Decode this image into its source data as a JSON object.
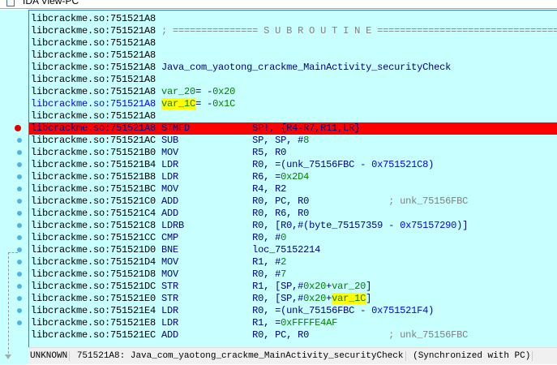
{
  "window_title": "IDA View-PC",
  "colors": {
    "bg": "#c8ffff",
    "breakpoint": "#ff0000",
    "highlight": "#ffff00"
  },
  "rows": [
    {
      "addr": "libcrackme.so:751521A8",
      "ac": "#000",
      "parts": []
    },
    {
      "addr": "libcrackme.so:751521A8",
      "ac": "#000",
      "parts": [
        {
          "t": "; =============== S U B R O U T I N E =======================================",
          "c": "#808080"
        }
      ]
    },
    {
      "addr": "libcrackme.so:751521A8",
      "ac": "#000",
      "parts": []
    },
    {
      "addr": "libcrackme.so:751521A8",
      "ac": "#000",
      "parts": []
    },
    {
      "addr": "libcrackme.so:751521A8",
      "ac": "#000",
      "parts": [
        {
          "t": "Java_com_yaotong_crackme_MainActivity_securityCheck",
          "c": "#000080"
        }
      ]
    },
    {
      "addr": "libcrackme.so:751521A8",
      "ac": "#000",
      "parts": []
    },
    {
      "addr": "libcrackme.so:751521A8",
      "ac": "#000",
      "parts": [
        {
          "t": "var_20",
          "c": "#008000"
        },
        {
          "t": "= -",
          "c": "#000080"
        },
        {
          "t": "0x20",
          "c": "#008000"
        }
      ]
    },
    {
      "addr": "libcrackme.so:751521A8",
      "ac": "#0000ff",
      "parts": [
        {
          "t": "var_1C",
          "c": "#008000",
          "hl": true
        },
        {
          "t": "= -",
          "c": "#000080"
        },
        {
          "t": "0x1C",
          "c": "#008000"
        }
      ]
    },
    {
      "addr": "libcrackme.so:751521A8",
      "ac": "#000",
      "parts": []
    },
    {
      "addr": "libcrackme.so:751521A8",
      "ac": "#000080",
      "bp": true,
      "parts": [
        {
          "t": "STMFD           ",
          "c": "#000080"
        },
        {
          "t": "SP!, {R4-R7,R11,LR}",
          "c": "#000080"
        }
      ]
    },
    {
      "addr": "libcrackme.so:751521AC",
      "ac": "#000",
      "dot": true,
      "parts": [
        {
          "t": "SUB             SP, SP, #",
          "c": "#000080"
        },
        {
          "t": "8",
          "c": "#008000"
        }
      ]
    },
    {
      "addr": "libcrackme.so:751521B0",
      "ac": "#000",
      "dot": true,
      "parts": [
        {
          "t": "MOV             R5, R0",
          "c": "#000080"
        }
      ]
    },
    {
      "addr": "libcrackme.so:751521B4",
      "ac": "#000",
      "dot": true,
      "parts": [
        {
          "t": "LDR             R0, =(unk_75156FBC - ",
          "c": "#000080"
        },
        {
          "t": "0x751521C8",
          "c": "#0000ff"
        },
        {
          "t": ")",
          "c": "#000080"
        }
      ]
    },
    {
      "addr": "libcrackme.so:751521B8",
      "ac": "#000",
      "dot": true,
      "parts": [
        {
          "t": "LDR             R6, =",
          "c": "#000080"
        },
        {
          "t": "0x2D4",
          "c": "#008000"
        }
      ]
    },
    {
      "addr": "libcrackme.so:751521BC",
      "ac": "#000",
      "dot": true,
      "parts": [
        {
          "t": "MOV             R4, R2",
          "c": "#000080"
        }
      ]
    },
    {
      "addr": "libcrackme.so:751521C0",
      "ac": "#000",
      "dot": true,
      "parts": [
        {
          "t": "ADD             R0, PC, R0              ",
          "c": "#000080"
        },
        {
          "t": "; unk_75156FBC",
          "c": "#808080"
        }
      ]
    },
    {
      "addr": "libcrackme.so:751521C4",
      "ac": "#000",
      "dot": true,
      "parts": [
        {
          "t": "ADD             R0, R6, R0",
          "c": "#000080"
        }
      ]
    },
    {
      "addr": "libcrackme.so:751521C8",
      "ac": "#000",
      "dot": true,
      "parts": [
        {
          "t": "LDRB            R0, [R0,#(byte_75157359 - ",
          "c": "#000080"
        },
        {
          "t": "0x75157290",
          "c": "#0000ff"
        },
        {
          "t": ")]",
          "c": "#000080"
        }
      ]
    },
    {
      "addr": "libcrackme.so:751521CC",
      "ac": "#000",
      "dot": true,
      "parts": [
        {
          "t": "CMP             R0, #",
          "c": "#000080"
        },
        {
          "t": "0",
          "c": "#008000"
        }
      ]
    },
    {
      "addr": "libcrackme.so:751521D0",
      "ac": "#000",
      "dot": true,
      "parts": [
        {
          "t": "BNE             loc_75152214",
          "c": "#000080"
        }
      ]
    },
    {
      "addr": "libcrackme.so:751521D4",
      "ac": "#000",
      "dot": true,
      "parts": [
        {
          "t": "MOV             R1, #",
          "c": "#000080"
        },
        {
          "t": "2",
          "c": "#008000"
        }
      ]
    },
    {
      "addr": "libcrackme.so:751521D8",
      "ac": "#000",
      "dot": true,
      "parts": [
        {
          "t": "MOV             R0, #",
          "c": "#000080"
        },
        {
          "t": "7",
          "c": "#008000"
        }
      ]
    },
    {
      "addr": "libcrackme.so:751521DC",
      "ac": "#000",
      "dot": true,
      "parts": [
        {
          "t": "STR             R1, [SP,#",
          "c": "#000080"
        },
        {
          "t": "0x20",
          "c": "#008000"
        },
        {
          "t": "+",
          "c": "#000080"
        },
        {
          "t": "var_20",
          "c": "#008000"
        },
        {
          "t": "]",
          "c": "#000080"
        }
      ]
    },
    {
      "addr": "libcrackme.so:751521E0",
      "ac": "#000",
      "dot": true,
      "parts": [
        {
          "t": "STR             R0, [SP,#",
          "c": "#000080"
        },
        {
          "t": "0x20",
          "c": "#008000"
        },
        {
          "t": "+",
          "c": "#000080"
        },
        {
          "t": "var_1C",
          "c": "#008000",
          "hl": true
        },
        {
          "t": "]",
          "c": "#000080"
        }
      ]
    },
    {
      "addr": "libcrackme.so:751521E4",
      "ac": "#000",
      "dot": true,
      "parts": [
        {
          "t": "LDR             R0, =(unk_75156FBC - ",
          "c": "#000080"
        },
        {
          "t": "0x751521F4",
          "c": "#0000ff"
        },
        {
          "t": ")",
          "c": "#000080"
        }
      ]
    },
    {
      "addr": "libcrackme.so:751521E8",
      "ac": "#000",
      "dot": true,
      "parts": [
        {
          "t": "LDR             R1, =",
          "c": "#000080"
        },
        {
          "t": "0xFFFFE4AF",
          "c": "#008000"
        }
      ]
    },
    {
      "addr": "libcrackme.so:751521EC",
      "ac": "#000",
      "parts": [
        {
          "t": "ADD             R0, PC, R0              ",
          "c": "#000080"
        },
        {
          "t": "; unk_75156FBC",
          "c": "#808080"
        }
      ]
    }
  ],
  "status": {
    "segment": "UNKNOWN",
    "location": "751521A8: Java_com_yaotong_crackme_MainActivity_securityCheck",
    "sync": "(Synchronized with PC)"
  }
}
